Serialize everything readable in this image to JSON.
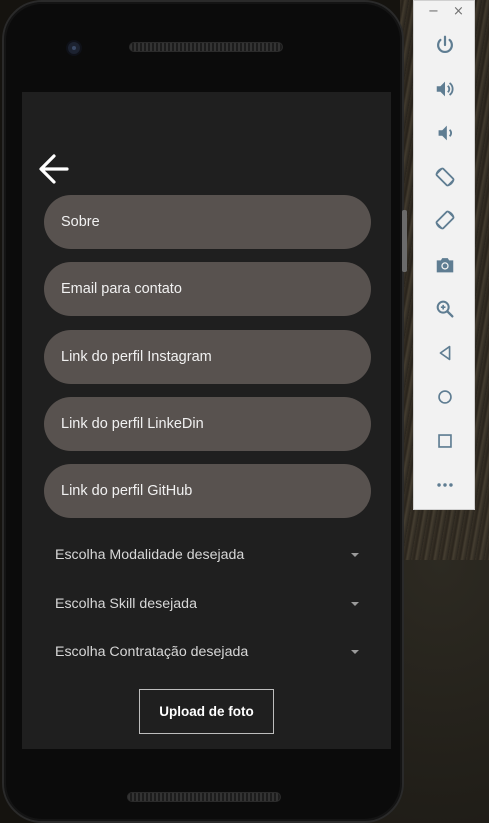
{
  "screen": {
    "fields": [
      {
        "placeholder": "Sobre"
      },
      {
        "placeholder": "Email para contato"
      },
      {
        "placeholder": "Link do perfil Instagram"
      },
      {
        "placeholder": "Link do perfil LinkeDin"
      },
      {
        "placeholder": "Link do perfil GitHub"
      }
    ],
    "selects": [
      {
        "label": "Escolha Modalidade desejada"
      },
      {
        "label": "Escolha Skill desejada"
      },
      {
        "label": "Escolha Contratação desejada"
      }
    ],
    "upload_label": "Upload de foto"
  },
  "window_controls": {
    "minimize": "−",
    "close": "×"
  },
  "emulator_controls": [
    {
      "icon": "power-icon"
    },
    {
      "icon": "volume-up-icon"
    },
    {
      "icon": "volume-down-icon"
    },
    {
      "icon": "rotate-left-icon"
    },
    {
      "icon": "rotate-right-icon"
    },
    {
      "icon": "camera-icon"
    },
    {
      "icon": "zoom-icon"
    },
    {
      "icon": "back-icon"
    },
    {
      "icon": "home-icon"
    },
    {
      "icon": "overview-icon"
    },
    {
      "icon": "more-icon"
    }
  ],
  "colors": {
    "field_bg": "#58524f",
    "screen_bg": "#1f1f1f",
    "panel_icon": "#5f7d92"
  }
}
